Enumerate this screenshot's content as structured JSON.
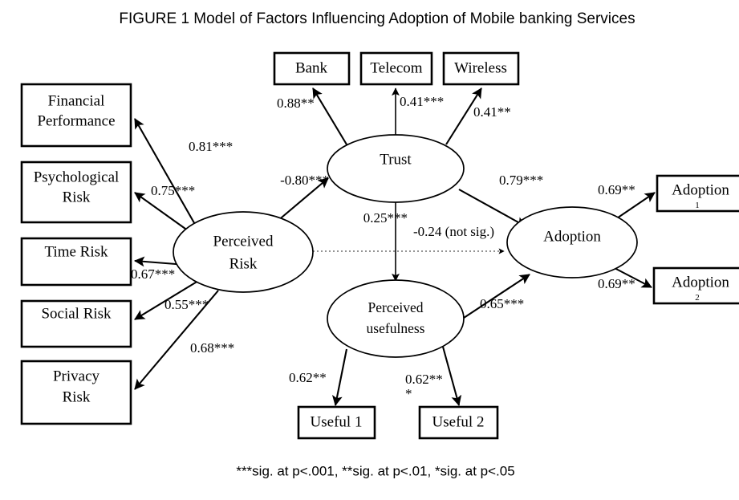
{
  "figure": {
    "title": "FIGURE 1 Model of Factors Influencing Adoption of Mobile banking Services",
    "footnote": "***sig. at p<.001, **sig. at p<.01, *sig. at p<.05"
  },
  "nodes": {
    "latent": [
      {
        "id": "perceived_risk",
        "label_line1": "Perceived",
        "label_line2": "Risk"
      },
      {
        "id": "trust",
        "label_line1": "Trust",
        "label_line2": ""
      },
      {
        "id": "perceived_usefulness",
        "label_line1": "Perceived",
        "label_line2": "usefulness"
      },
      {
        "id": "adoption",
        "label_line1": "Adoption",
        "label_line2": ""
      }
    ],
    "indicators_left": [
      {
        "id": "financial_performance",
        "label_line1": "Financial",
        "label_line2": "Performance"
      },
      {
        "id": "psychological_risk",
        "label_line1": "Psychological",
        "label_line2": "Risk"
      },
      {
        "id": "time_risk",
        "label_line1": "Time Risk",
        "label_line2": ""
      },
      {
        "id": "social_risk",
        "label_line1": "Social Risk",
        "label_line2": ""
      },
      {
        "id": "privacy_risk",
        "label_line1": "Privacy",
        "label_line2": "Risk"
      }
    ],
    "indicators_top": [
      {
        "id": "bank",
        "label": "Bank"
      },
      {
        "id": "telecom",
        "label": "Telecom"
      },
      {
        "id": "wireless",
        "label": "Wireless"
      }
    ],
    "indicators_bottom": [
      {
        "id": "useful_1",
        "label": "Useful 1"
      },
      {
        "id": "useful_2",
        "label": "Useful 2"
      }
    ],
    "indicators_right": [
      {
        "id": "adoption_1",
        "label": "Adoption",
        "subscript": "1"
      },
      {
        "id": "adoption_2",
        "label": "Adoption",
        "subscript": "2"
      }
    ]
  },
  "chart_data": {
    "type": "diagram",
    "title": "FIGURE 1 Model of Factors Influencing Adoption of Mobile banking Services",
    "diagram_kind": "structural-equation-model-path-diagram",
    "paths": [
      {
        "from": "perceived_risk",
        "to": "financial_performance",
        "coefficient": "0.81***",
        "value": 0.81,
        "significance": "p<.001",
        "significant": true
      },
      {
        "from": "perceived_risk",
        "to": "psychological_risk",
        "coefficient": "0.75***",
        "value": 0.75,
        "significance": "p<.001",
        "significant": true
      },
      {
        "from": "perceived_risk",
        "to": "time_risk",
        "coefficient": "0.67***",
        "value": 0.67,
        "significance": "p<.001",
        "significant": true
      },
      {
        "from": "perceived_risk",
        "to": "social_risk",
        "coefficient": "0.55***",
        "value": 0.55,
        "significance": "p<.001",
        "significant": true
      },
      {
        "from": "perceived_risk",
        "to": "privacy_risk",
        "coefficient": "0.68***",
        "value": 0.68,
        "significance": "p<.001",
        "significant": true
      },
      {
        "from": "perceived_risk",
        "to": "trust",
        "coefficient": "-0.80***",
        "value": -0.8,
        "significance": "p<.001",
        "significant": true
      },
      {
        "from": "perceived_risk",
        "to": "adoption",
        "coefficient": "-0.24 (not sig.)",
        "value": -0.24,
        "significance": "not sig.",
        "significant": false
      },
      {
        "from": "trust",
        "to": "bank",
        "coefficient": "0.88**",
        "value": 0.88,
        "significance": "p<.01",
        "significant": true
      },
      {
        "from": "trust",
        "to": "telecom",
        "coefficient": "0.41***",
        "value": 0.41,
        "significance": "p<.001",
        "significant": true
      },
      {
        "from": "trust",
        "to": "wireless",
        "coefficient": "0.41**",
        "value": 0.41,
        "significance": "p<.01",
        "significant": true
      },
      {
        "from": "trust",
        "to": "perceived_usefulness",
        "coefficient": "0.25***",
        "value": 0.25,
        "significance": "p<.001",
        "significant": true
      },
      {
        "from": "trust",
        "to": "adoption",
        "coefficient": "0.79***",
        "value": 0.79,
        "significance": "p<.001",
        "significant": true
      },
      {
        "from": "perceived_usefulness",
        "to": "useful_1",
        "coefficient": "0.62**",
        "value": 0.62,
        "significance": "p<.01",
        "significant": true
      },
      {
        "from": "perceived_usefulness",
        "to": "useful_2",
        "coefficient": "0.62***",
        "value": 0.62,
        "significance": "p<.001",
        "significant": true
      },
      {
        "from": "perceived_usefulness",
        "to": "adoption",
        "coefficient": "0.65***",
        "value": 0.65,
        "significance": "p<.001",
        "significant": true
      },
      {
        "from": "adoption",
        "to": "adoption_1",
        "coefficient": "0.69**",
        "value": 0.69,
        "significance": "p<.01",
        "significant": true
      },
      {
        "from": "adoption",
        "to": "adoption_2",
        "coefficient": "0.69**",
        "value": 0.69,
        "significance": "p<.01",
        "significant": true
      }
    ]
  },
  "labels": {
    "c_financial": "0.81***",
    "c_psychological": "0.75***",
    "c_time": "0.67***",
    "c_social": "0.55***",
    "c_privacy": "0.68***",
    "c_risk_trust": "-0.80***",
    "c_risk_adoption": "-0.24 (not sig.)",
    "c_bank": "0.88**",
    "c_telecom": "0.41***",
    "c_wireless": "0.41**",
    "c_trust_pu": "0.25***",
    "c_trust_adoption": "0.79***",
    "c_useful1": "0.62**",
    "c_useful2_line1": "0.62**",
    "c_useful2_line2": "*",
    "c_pu_adoption": "0.65***",
    "c_adoption1": "0.69**",
    "c_adoption2": "0.69**"
  },
  "colors": {
    "background": "#ffffff",
    "stroke": "#000000",
    "dotted_stroke": "#555555"
  }
}
